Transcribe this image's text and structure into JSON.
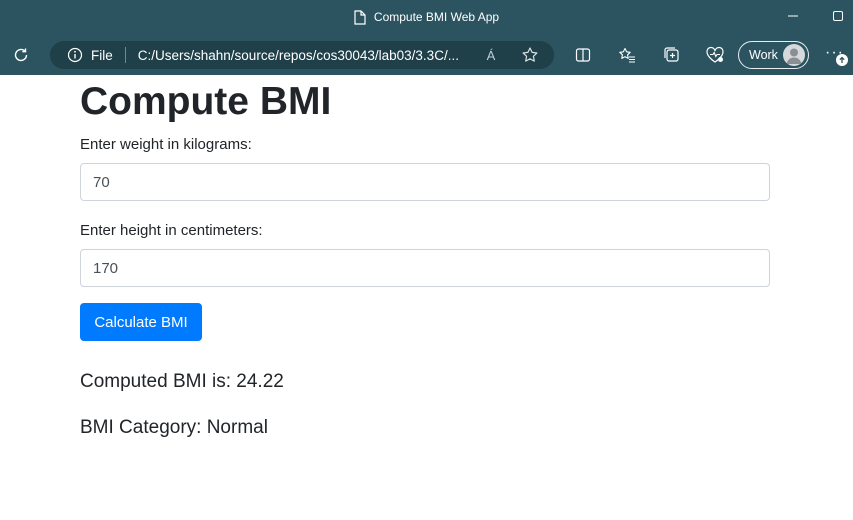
{
  "browser": {
    "window_title": "Compute BMI Web App",
    "file_label": "File",
    "url": "C:/Users/shahn/source/repos/cos30043/lab03/3.3C/...",
    "read_aloud_glyph": "Á",
    "profile_label": "Work",
    "more_label": "···",
    "theme_color": "#2b5460"
  },
  "page": {
    "heading": "Compute BMI",
    "weight_label": "Enter weight in kilograms:",
    "weight_value": "70",
    "height_label": "Enter height in centimeters:",
    "height_value": "170",
    "calculate_button": "Calculate BMI",
    "result_text": "Computed BMI is: 24.22",
    "category_text": "BMI Category: Normal",
    "button_color": "#007bff"
  }
}
